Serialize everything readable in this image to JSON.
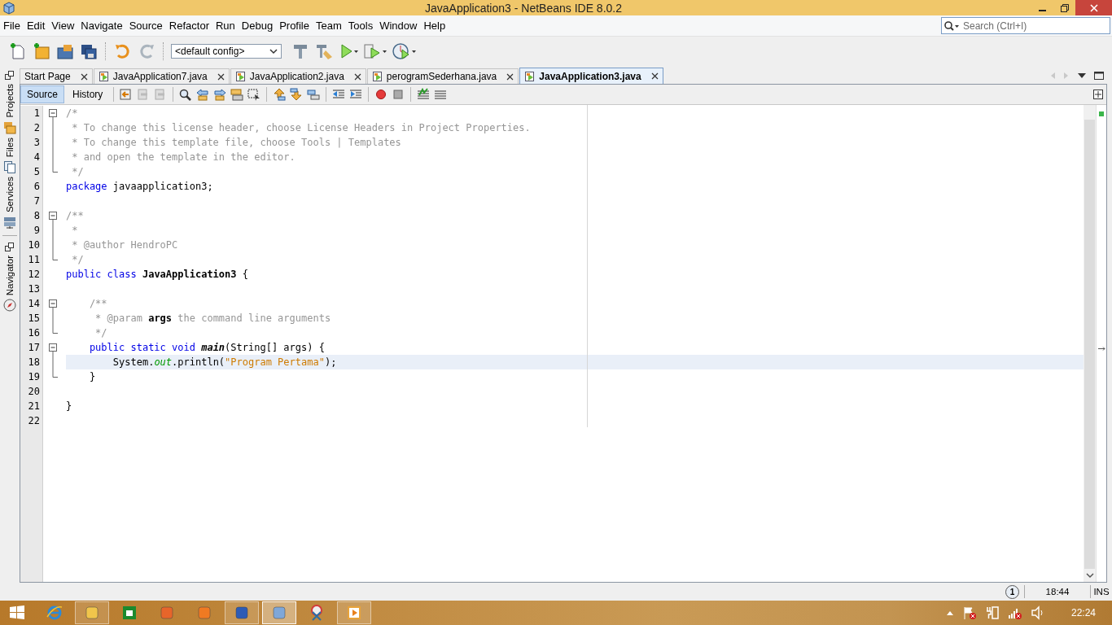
{
  "window": {
    "title": "JavaApplication3 - NetBeans IDE 8.0.2"
  },
  "menu": [
    "File",
    "Edit",
    "View",
    "Navigate",
    "Source",
    "Refactor",
    "Run",
    "Debug",
    "Profile",
    "Team",
    "Tools",
    "Window",
    "Help"
  ],
  "toolbar": {
    "config": "<default config>"
  },
  "search": {
    "placeholder": "Search (Ctrl+I)"
  },
  "side_tabs": [
    "Projects",
    "Files",
    "Services",
    "Navigator"
  ],
  "tabs": [
    {
      "label": "Start Page",
      "selected": false
    },
    {
      "label": "JavaApplication7.java",
      "selected": false
    },
    {
      "label": "JavaApplication2.java",
      "selected": false
    },
    {
      "label": "perogramSederhana.java",
      "selected": false
    },
    {
      "label": "JavaApplication3.java",
      "selected": true
    }
  ],
  "editor_modes": [
    {
      "label": "Source",
      "selected": true
    },
    {
      "label": "History",
      "selected": false
    }
  ],
  "lines": [
    {
      "number": "1",
      "kind": "start",
      "current": false,
      "tokens": [
        {
          "kind": "comment",
          "t": "/*"
        }
      ]
    },
    {
      "number": "2",
      "kind": "body",
      "current": false,
      "tokens": [
        {
          "kind": "comment",
          "t": " * To change this license header, choose License Headers in Project Properties."
        }
      ]
    },
    {
      "number": "3",
      "kind": "body",
      "current": false,
      "tokens": [
        {
          "kind": "comment",
          "t": " * To change this template file, choose Tools | Templates"
        }
      ]
    },
    {
      "number": "4",
      "kind": "body",
      "current": false,
      "tokens": [
        {
          "kind": "comment",
          "t": " * and open the template in the editor."
        }
      ]
    },
    {
      "number": "5",
      "kind": "end",
      "current": false,
      "tokens": [
        {
          "kind": "comment",
          "t": " */"
        }
      ]
    },
    {
      "number": "6",
      "kind": "plain",
      "current": false,
      "tokens": [
        {
          "kind": "keyword",
          "t": "package"
        },
        {
          "kind": "plain",
          "t": " javaapplication3;"
        }
      ]
    },
    {
      "number": "7",
      "kind": "plain",
      "current": false
    },
    {
      "number": "8",
      "kind": "start",
      "current": false,
      "tokens": [
        {
          "kind": "comment",
          "t": "/**"
        }
      ]
    },
    {
      "number": "9",
      "kind": "body",
      "current": false,
      "tokens": [
        {
          "kind": "comment",
          "t": " *"
        }
      ]
    },
    {
      "number": "10",
      "kind": "body",
      "current": false,
      "tokens": [
        {
          "kind": "comment",
          "t": " * @author HendroPC"
        }
      ]
    },
    {
      "number": "11",
      "kind": "end",
      "current": false,
      "tokens": [
        {
          "kind": "comment",
          "t": " */"
        }
      ]
    },
    {
      "number": "12",
      "kind": "plain",
      "current": false,
      "tokens": [
        {
          "kind": "keyword",
          "t": "public class"
        },
        {
          "kind": "declaration",
          "t": " JavaApplication3"
        },
        {
          "kind": "plain",
          "t": " {"
        }
      ]
    },
    {
      "number": "13",
      "kind": "plain",
      "current": false
    },
    {
      "number": "14",
      "kind": "start",
      "current": false,
      "tokens": [
        {
          "kind": "comment",
          "t": "    /**"
        }
      ]
    },
    {
      "number": "15",
      "kind": "body",
      "current": false,
      "tokens": [
        {
          "kind": "comment",
          "t": "     * @param "
        },
        {
          "kind": "parameter",
          "t": "args"
        },
        {
          "kind": "comment",
          "t": " the command line arguments"
        }
      ]
    },
    {
      "number": "16",
      "kind": "end",
      "current": false,
      "tokens": [
        {
          "kind": "comment",
          "t": "     */"
        }
      ]
    },
    {
      "number": "17",
      "kind": "start",
      "current": false,
      "tokens": [
        {
          "kind": "keyword",
          "t": "    public static void"
        },
        {
          "kind": "method",
          "t": " main"
        },
        {
          "kind": "plain",
          "t": "(String[] args) {"
        }
      ]
    },
    {
      "number": "18",
      "kind": "body",
      "current": true,
      "tokens": [
        {
          "kind": "plain",
          "t": "        System."
        },
        {
          "kind": "field",
          "t": "out"
        },
        {
          "kind": "plain",
          "t": ".println("
        },
        {
          "kind": "string",
          "t": "\"Program Pertama\""
        },
        {
          "kind": "plain",
          "t": ");"
        }
      ]
    },
    {
      "number": "19",
      "kind": "end",
      "current": false,
      "tokens": [
        {
          "kind": "plain",
          "t": "    }"
        }
      ]
    },
    {
      "number": "20",
      "kind": "plain",
      "current": false
    },
    {
      "number": "21",
      "kind": "plain",
      "current": false,
      "tokens": [
        {
          "kind": "plain",
          "t": "}"
        }
      ]
    },
    {
      "number": "22",
      "kind": "plain",
      "current": false
    }
  ],
  "status_bar": {
    "notifications": "1",
    "position": "18:44",
    "mode": "INS"
  },
  "taskbar": {
    "apps": [
      {
        "running": false,
        "active": false
      },
      {
        "running": false,
        "active": false
      },
      {
        "running": true,
        "active": false
      },
      {
        "running": false,
        "active": false
      },
      {
        "running": false,
        "active": false
      },
      {
        "running": false,
        "active": false
      },
      {
        "running": true,
        "active": false
      },
      {
        "running": true,
        "active": true
      },
      {
        "running": false,
        "active": false
      },
      {
        "running": true,
        "active": false
      }
    ],
    "clock": "22:24"
  }
}
